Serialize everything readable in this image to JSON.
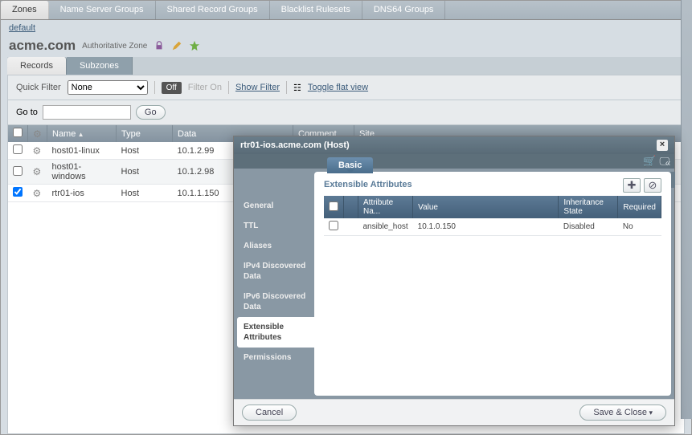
{
  "nav": {
    "tabs": [
      "Zones",
      "Name Server Groups",
      "Shared Record Groups",
      "Blacklist Rulesets",
      "DNS64 Groups"
    ]
  },
  "breadcrumb": {
    "parent": "default"
  },
  "zone": {
    "name": "acme.com",
    "type": "Authoritative Zone"
  },
  "subtabs": {
    "records": "Records",
    "subzones": "Subzones"
  },
  "toolbar": {
    "quick_filter": "Quick Filter",
    "filter_value": "None",
    "off": "Off",
    "filter_on": "Filter On",
    "show_filter": "Show Filter",
    "toggle_flat": "Toggle flat view"
  },
  "gotobar": {
    "label": "Go to",
    "button": "Go"
  },
  "grid": {
    "cols": {
      "name": "Name",
      "type": "Type",
      "data": "Data",
      "comment": "Comment",
      "site": "Site"
    },
    "rows": [
      {
        "name": "host01-linux",
        "type": "Host",
        "data": "10.1.2.99"
      },
      {
        "name": "host01-windows",
        "type": "Host",
        "data": "10.1.2.98"
      },
      {
        "name": "rtr01-ios",
        "type": "Host",
        "data": "10.1.1.150"
      }
    ]
  },
  "modal": {
    "title": "rtr01-ios.acme.com (Host)",
    "basic_tab": "Basic",
    "menu": {
      "general": "General",
      "ttl": "TTL",
      "aliases": "Aliases",
      "ipv4": "IPv4 Discovered Data",
      "ipv6": "IPv6 Discovered Data",
      "ea": "Extensible Attributes",
      "perm": "Permissions"
    },
    "panel_title": "Extensible Attributes",
    "ea_cols": {
      "name": "Attribute Na...",
      "value": "Value",
      "inherit": "Inheritance State",
      "required": "Required"
    },
    "ea_rows": [
      {
        "name": "ansible_host",
        "value": "10.1.0.150",
        "inherit": "Disabled",
        "required": "No"
      }
    ],
    "cancel": "Cancel",
    "save": "Save & Close"
  }
}
